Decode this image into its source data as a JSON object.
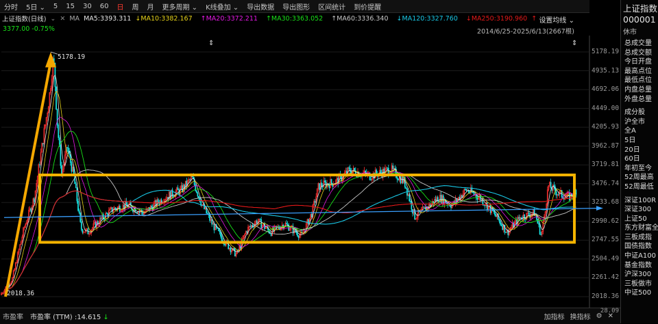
{
  "toolbar": {
    "items": [
      "分时",
      "5日",
      "5",
      "15",
      "30",
      "60",
      "日",
      "周",
      "月",
      "更多周期",
      "K线叠加",
      "导出数据",
      "导出图形",
      "区间统计",
      "到价提醒"
    ],
    "active": "日",
    "icons": [
      "settings-circle",
      "help-circle",
      "close"
    ]
  },
  "ma": {
    "title": "上证指数(日线)",
    "ma_label": "MA",
    "ma5": "MA5:3393.311",
    "ma10": "MA10:3382.167",
    "ma20": "MA20:3372.211",
    "ma30": "MA30:3363.052",
    "ma60": "MA60:3336.340",
    "ma120": "MA120:3327.760",
    "ma250": "MA250:3190.960",
    "colors": {
      "ma5": "#e6e6e6",
      "ma10": "#e6d219",
      "ma20": "#e619e6",
      "ma30": "#19e119",
      "ma60": "#c8c8c8",
      "ma120": "#19c8e6",
      "ma250": "#e61919"
    },
    "settings": "设置均线"
  },
  "price_info": "3377.00  -0.75%",
  "range": "2014/6/25-2025/6/13(2667根)",
  "chart_data": {
    "type": "candlestick",
    "title": "上证指数(日线)",
    "ylim": [
      2018.36,
      5178.19
    ],
    "y_ticks": [
      "5178.19",
      "4935.13",
      "4692.06",
      "4449.00",
      "4205.93",
      "3962.87",
      "3719.81",
      "3476.74",
      "3233.68",
      "2990.62",
      "2747.55",
      "2504.49",
      "2261.42",
      "2018.36"
    ],
    "peak_label": "5178.19",
    "low_label": "2018.36",
    "x_range": [
      "2014/6/25",
      "2025/6/13"
    ],
    "bars": 2667
  },
  "sidebar": {
    "title": "上证指数",
    "code": "000001",
    "state": "休市",
    "stats": [
      "总成交量",
      "总成交额",
      "今日开盘",
      "最高点位",
      "最低点位",
      "内盘总量",
      "外盘总量"
    ],
    "periods": [
      "成分股",
      "沪全市",
      "全A",
      "5日",
      "20日",
      "60日",
      "年初至今",
      "52周最高",
      "52周最低"
    ],
    "indices": [
      "深证100R",
      "深证300",
      "上证50",
      "东方财富全A",
      "三板成指",
      "国债指数",
      "中证A100",
      "基金指数",
      "沪深300",
      "三板做市",
      "中证500"
    ]
  },
  "bottom": {
    "label1": "市盈率",
    "label2": "市盈率 (TTM) :14.615",
    "arrow": "↓",
    "add": "加指标",
    "change": "换指标",
    "value": "28.09"
  }
}
